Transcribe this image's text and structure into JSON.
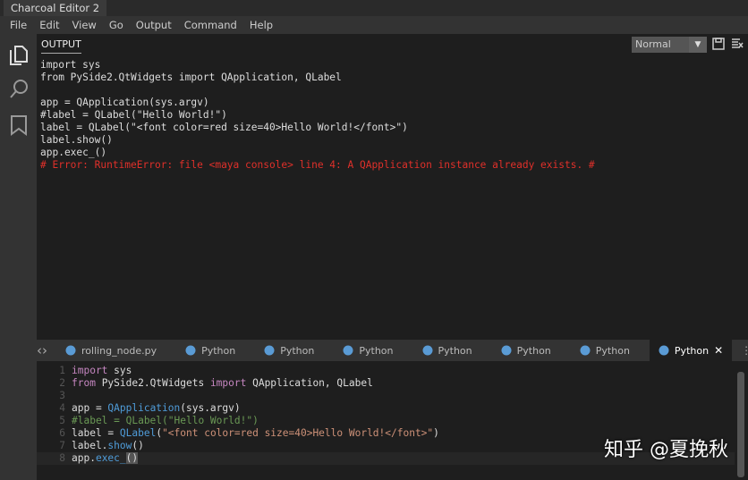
{
  "title": "Charcoal Editor 2",
  "menu": [
    "File",
    "Edit",
    "View",
    "Go",
    "Output",
    "Command",
    "Help"
  ],
  "output": {
    "tab": "OUTPUT",
    "mode": "Normal",
    "lines": [
      "import sys",
      "from PySide2.QtWidgets import QApplication, QLabel",
      "",
      "app = QApplication(sys.argv)",
      "#label = QLabel(\"Hello World!\")",
      "label = QLabel(\"<font color=red size=40>Hello World!</font>\")",
      "label.show()",
      "app.exec_()"
    ],
    "error": "# Error: RuntimeError: file <maya console> line 4: A QApplication instance already exists. #"
  },
  "tabs": [
    "rolling_node.py",
    "Python",
    "Python",
    "Python",
    "Python",
    "Python",
    "Python",
    "Python"
  ],
  "editor": {
    "line_numbers": [
      "1",
      "2",
      "3",
      "4",
      "5",
      "6",
      "7",
      "8"
    ]
  },
  "watermark": "知乎 @夏挽秋",
  "colors": {
    "error": "#e0302a",
    "background": "#1e1e1e"
  }
}
